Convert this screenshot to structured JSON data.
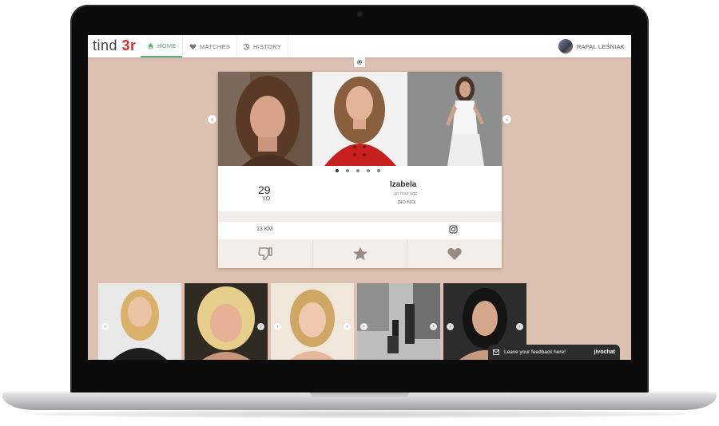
{
  "nav": {
    "logo_prefix": "tind",
    "logo_suffix": "3r",
    "tabs": [
      {
        "label": "HOME",
        "icon": "home-icon",
        "active": true
      },
      {
        "label": "MATCHES",
        "icon": "heart-icon",
        "active": false
      },
      {
        "label": "HISTORY",
        "icon": "history-icon",
        "active": false
      }
    ],
    "user_name": "RAFAŁ LEŚNIAK"
  },
  "profile": {
    "age": "29",
    "age_unit": "YO",
    "name": "Izabela",
    "last_seen": "an hour ago",
    "bio": "[NO BIO]",
    "distance": "13 KM",
    "photo_count": 5,
    "active_photo_index": 0
  },
  "actions": [
    {
      "name": "dislike-button",
      "icon": "thumbs-down-icon"
    },
    {
      "name": "superlike-button",
      "icon": "star-icon"
    },
    {
      "name": "like-button",
      "icon": "heart-icon"
    }
  ],
  "thumbnail_count": 5,
  "feedback": {
    "label": "Leave your feedback here!",
    "brand": "jivochat"
  },
  "colors": {
    "background": "#dcc0b2",
    "accent_green": "#5fb37a",
    "logo_red": "#d0332e",
    "action_icon": "#9a8a80"
  }
}
